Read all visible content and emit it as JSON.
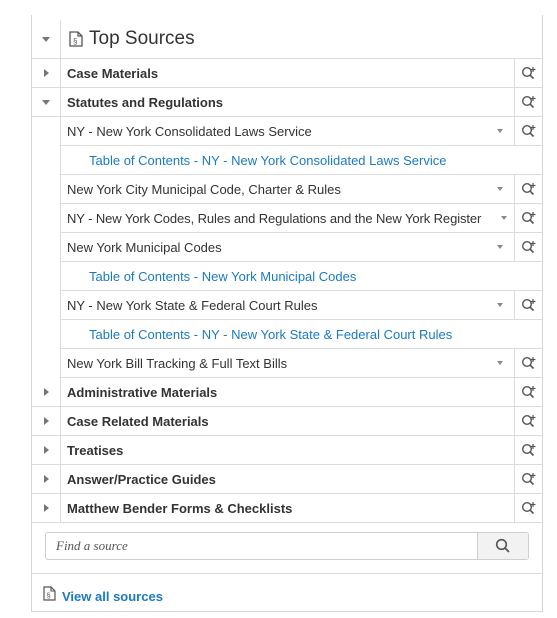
{
  "header": {
    "title": "Top Sources",
    "doc_icon": "document-icon"
  },
  "categories": [
    {
      "label": "Case Materials"
    },
    {
      "label": "Statutes and Regulations"
    },
    {
      "label": "Administrative Materials"
    },
    {
      "label": "Case Related Materials"
    },
    {
      "label": "Treatises"
    },
    {
      "label": "Answer/Practice Guides"
    },
    {
      "label": "Matthew Bender Forms & Checklists"
    }
  ],
  "sources": [
    {
      "label": "NY - New York Consolidated Laws Service"
    },
    {
      "label": "Table of Contents - NY - New York Consolidated Laws Service"
    },
    {
      "label": "New York City Municipal Code, Charter & Rules"
    },
    {
      "label": "NY - New York Codes, Rules and Regulations and the New York Register"
    },
    {
      "label": "New York Municipal Codes"
    },
    {
      "label": "Table of Contents - New York Municipal Codes"
    },
    {
      "label": "NY - New York State & Federal Court Rules"
    },
    {
      "label": "Table of Contents - NY - New York State & Federal Court Rules"
    },
    {
      "label": "New York Bill Tracking & Full Text Bills"
    }
  ],
  "search": {
    "placeholder": "Find a source"
  },
  "footer": {
    "view_all": "View all sources"
  },
  "colors": {
    "accent_red": "#cf2127",
    "link_blue": "#1a7ac4"
  }
}
